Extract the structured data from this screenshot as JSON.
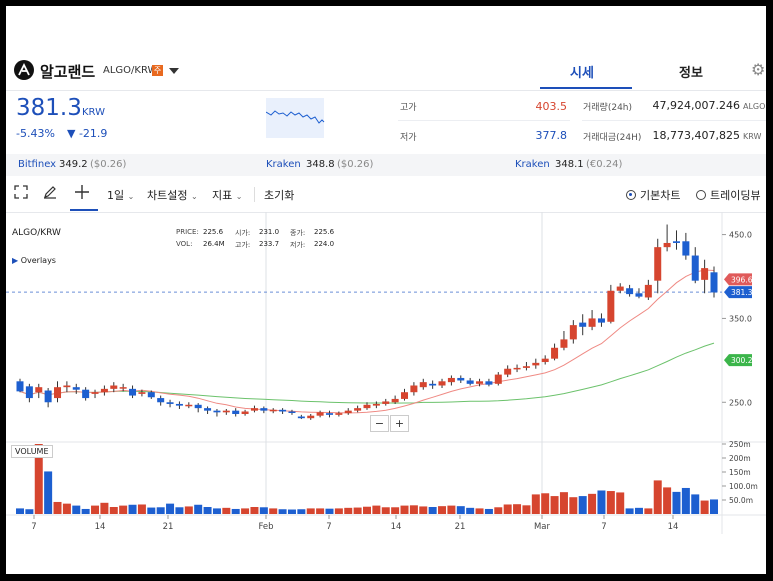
{
  "header": {
    "coin_name": "알고랜드",
    "pair": "ALGO/KRW",
    "warning_badge": "주",
    "tabs": [
      "시세",
      "정보"
    ],
    "active_tab": "시세"
  },
  "price_panel": {
    "price": "381.3",
    "currency": "KRW",
    "change_pct": "-5.43%",
    "change_abs": "▼ -21.9",
    "high_label": "고가",
    "high": "403.5",
    "low_label": "저가",
    "low": "377.8",
    "volume_label": "거래량(24h)",
    "volume": "47,924,007.246",
    "volume_unit": "ALGO",
    "value_label": "거래대금(24H)",
    "value": "18,773,407,825",
    "value_unit": "KRW"
  },
  "exchanges": [
    {
      "name": "Bitfinex",
      "price": "349.2",
      "diff": "($0.26)"
    },
    {
      "name": "Kraken",
      "price": "348.8",
      "diff": "($0.26)"
    },
    {
      "name": "Kraken",
      "price": "348.1",
      "diff": "(€0.24)"
    }
  ],
  "toolbar": {
    "interval": "1일",
    "chart_settings": "차트설정",
    "indicators": "지표",
    "reset": "초기화",
    "chart_modes": [
      "기본차트",
      "트레이딩뷰"
    ],
    "active_mode": "기본차트",
    "icons": [
      "fullscreen-icon",
      "draw-pencil-icon",
      "crosshair-icon"
    ]
  },
  "chart_info": {
    "symbol": "ALGO/KRW",
    "overlays": "Overlays",
    "ohlc_labels": [
      "PRICE:",
      "시가:",
      "종가:",
      "VOL:",
      "고가:",
      "저가:"
    ],
    "ohlc_values": [
      "225.6",
      "231.0",
      "225.6",
      "26.4M",
      "233.7",
      "224.0"
    ],
    "volume_label": "VOLUME",
    "zoom_out": "−",
    "zoom_in": "+"
  },
  "chart_data": {
    "type": "candlestick",
    "price_ticks": [
      "450.0",
      "350.0",
      "250.0"
    ],
    "volume_ticks": [
      "250m",
      "200m",
      "150m",
      "100.0m",
      "50.0m"
    ],
    "x_ticks": [
      "7",
      "14",
      "21",
      "Feb",
      "7",
      "14",
      "21",
      "Mar",
      "7",
      "14"
    ],
    "tags": [
      {
        "label": "396.6",
        "value": 396.6,
        "color": "#e05a5a"
      },
      {
        "label": "381.3",
        "value": 381.3,
        "color": "#1d5fd0"
      },
      {
        "label": "300.2",
        "value": 300.2,
        "color": "#3bb54a"
      }
    ],
    "current_price": 381.3,
    "up_color": "#d6452f",
    "down_color": "#1d5fd0",
    "ma_short_color": "#ef8a84",
    "ma_long_color": "#6cc26c",
    "candles": [
      [
        275,
        263,
        278,
        262
      ],
      [
        269,
        255,
        272,
        250
      ],
      [
        262,
        268,
        272,
        255
      ],
      [
        264,
        250,
        267,
        244
      ],
      [
        255,
        268,
        275,
        250
      ],
      [
        268,
        270,
        275,
        262
      ],
      [
        268,
        265,
        272,
        260
      ],
      [
        265,
        255,
        268,
        252
      ],
      [
        260,
        262,
        265,
        255
      ],
      [
        262,
        266,
        270,
        258
      ],
      [
        266,
        270,
        274,
        262
      ],
      [
        268,
        268,
        272,
        263
      ],
      [
        266,
        258,
        270,
        255
      ],
      [
        260,
        262,
        265,
        257
      ],
      [
        262,
        256,
        264,
        254
      ],
      [
        255,
        250,
        258,
        246
      ],
      [
        250,
        248,
        253,
        244
      ],
      [
        248,
        246,
        251,
        242
      ],
      [
        246,
        247,
        250,
        243
      ],
      [
        247,
        243,
        249,
        238
      ],
      [
        243,
        240,
        245,
        236
      ],
      [
        240,
        238,
        242,
        233
      ],
      [
        238,
        240,
        242,
        235
      ],
      [
        240,
        236,
        243,
        233
      ],
      [
        236,
        239,
        241,
        234
      ],
      [
        240,
        243,
        246,
        238
      ],
      [
        243,
        240,
        245,
        237
      ],
      [
        240,
        241,
        243,
        237
      ],
      [
        241,
        239,
        243,
        236
      ],
      [
        239,
        238,
        241,
        235
      ],
      [
        233,
        231,
        235,
        230
      ],
      [
        231,
        234,
        236,
        229
      ],
      [
        234,
        238,
        240,
        232
      ],
      [
        237,
        235,
        240,
        232
      ],
      [
        235,
        237,
        239,
        233
      ],
      [
        237,
        240,
        243,
        235
      ],
      [
        240,
        243,
        246,
        238
      ],
      [
        243,
        247,
        250,
        241
      ],
      [
        246,
        248,
        251,
        243
      ],
      [
        248,
        251,
        254,
        246
      ],
      [
        250,
        254,
        258,
        248
      ],
      [
        254,
        262,
        266,
        252
      ],
      [
        262,
        270,
        274,
        258
      ],
      [
        268,
        274,
        278,
        265
      ],
      [
        272,
        270,
        276,
        266
      ],
      [
        270,
        275,
        278,
        267
      ],
      [
        274,
        279,
        282,
        270
      ],
      [
        279,
        276,
        282,
        273
      ],
      [
        276,
        272,
        279,
        270
      ],
      [
        272,
        275,
        278,
        269
      ],
      [
        275,
        271,
        278,
        269
      ],
      [
        272,
        283,
        286,
        270
      ],
      [
        283,
        290,
        294,
        280
      ],
      [
        290,
        291,
        295,
        286
      ],
      [
        291,
        293,
        298,
        288
      ],
      [
        294,
        297,
        302,
        290
      ],
      [
        298,
        302,
        306,
        295
      ],
      [
        302,
        315,
        320,
        300
      ],
      [
        315,
        325,
        335,
        312
      ],
      [
        325,
        342,
        348,
        320
      ],
      [
        345,
        340,
        355,
        330
      ],
      [
        340,
        350,
        360,
        336
      ],
      [
        350,
        345,
        356,
        340
      ],
      [
        346,
        383,
        390,
        344
      ],
      [
        383,
        388,
        392,
        380
      ],
      [
        386,
        379,
        390,
        376
      ],
      [
        380,
        376,
        386,
        374
      ],
      [
        375,
        390,
        396,
        372
      ],
      [
        395,
        435,
        445,
        380
      ],
      [
        435,
        440,
        462,
        430
      ],
      [
        442,
        440,
        455,
        432
      ],
      [
        442,
        425,
        452,
        420
      ],
      [
        425,
        395,
        435,
        392
      ],
      [
        396,
        410,
        420,
        380
      ],
      [
        405,
        381,
        412,
        375
      ]
    ],
    "volumes": [
      20,
      17,
      250,
      152,
      43,
      37,
      30,
      18,
      30,
      40,
      25,
      30,
      33,
      34,
      23,
      24,
      37,
      24,
      27,
      33,
      25,
      20,
      22,
      18,
      20,
      25,
      24,
      20,
      17,
      16,
      17,
      20,
      20,
      19,
      20,
      22,
      23,
      26,
      30,
      24,
      24,
      30,
      31,
      27,
      25,
      28,
      30,
      28,
      22,
      20,
      18,
      24,
      34,
      35,
      31,
      70,
      74,
      64,
      78,
      60,
      64,
      72,
      84,
      82,
      77,
      20,
      22,
      20,
      120,
      95,
      79,
      93,
      70,
      48,
      52
    ]
  }
}
